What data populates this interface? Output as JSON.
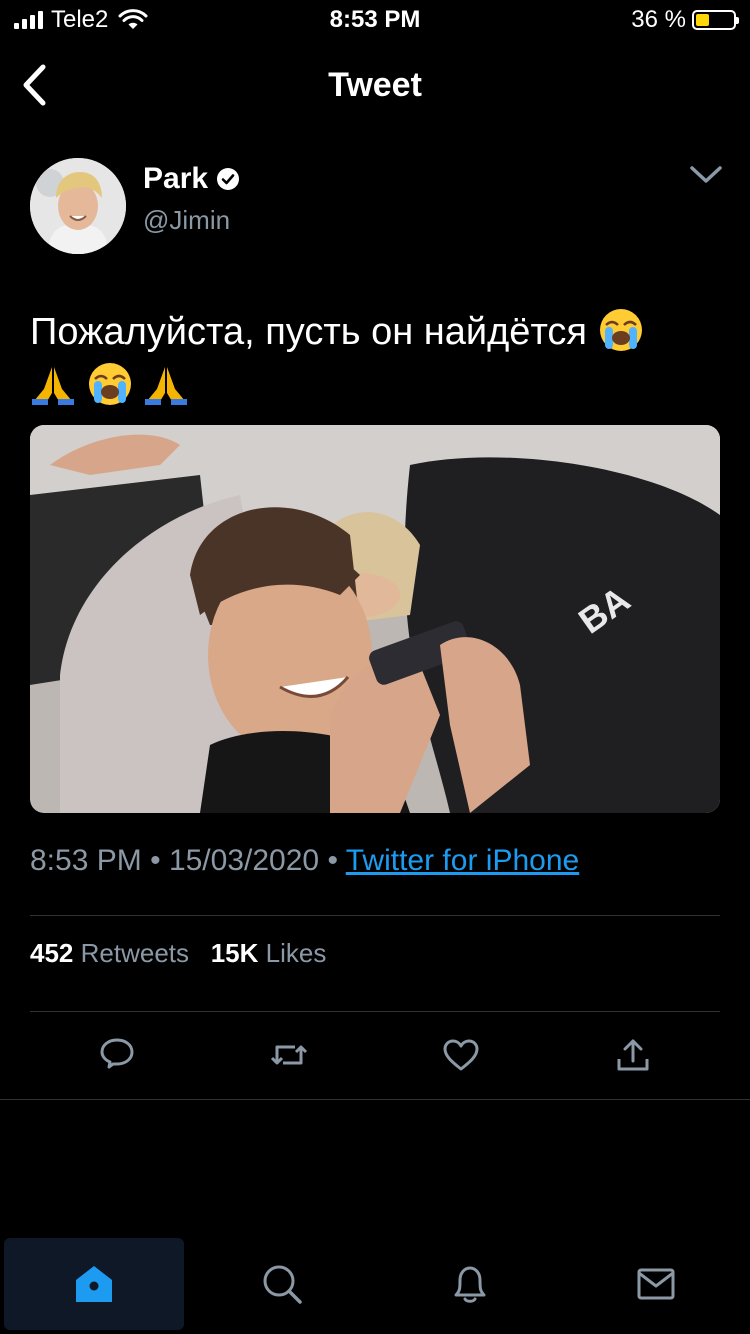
{
  "status_bar": {
    "carrier": "Tele2",
    "time": "8:53 PM",
    "battery": "36 %",
    "battery_level": 0.36
  },
  "header": {
    "title": "Tweet",
    "back_icon": "chevron-left-icon"
  },
  "author": {
    "name": "Park",
    "handle": "@Jimin",
    "verified": true
  },
  "tweet": {
    "text": "Пожалуйста, пусть он найдётся",
    "emoji_line1": [
      "loudly-crying-face"
    ],
    "emoji_line2": [
      "folded-hands",
      "loudly-crying-face",
      "folded-hands"
    ],
    "time": "8:53 PM",
    "date": "15/03/2020",
    "source": "Twitter for iPhone",
    "separator": "•"
  },
  "stats": {
    "retweets_count": "452",
    "retweets_label": "Retweets",
    "likes_count": "15K",
    "likes_label": "Likes"
  },
  "actions": [
    "reply-icon",
    "retweet-icon",
    "like-icon",
    "share-icon"
  ],
  "tabs": [
    {
      "icon": "home-icon",
      "active": true
    },
    {
      "icon": "search-icon",
      "active": false
    },
    {
      "icon": "notifications-icon",
      "active": false
    },
    {
      "icon": "messages-icon",
      "active": false
    }
  ],
  "colors": {
    "background": "#000000",
    "accent": "#1d9bf0",
    "secondary_text": "#8b98a5",
    "divider": "#2f3336",
    "battery": "#ffd60a"
  }
}
